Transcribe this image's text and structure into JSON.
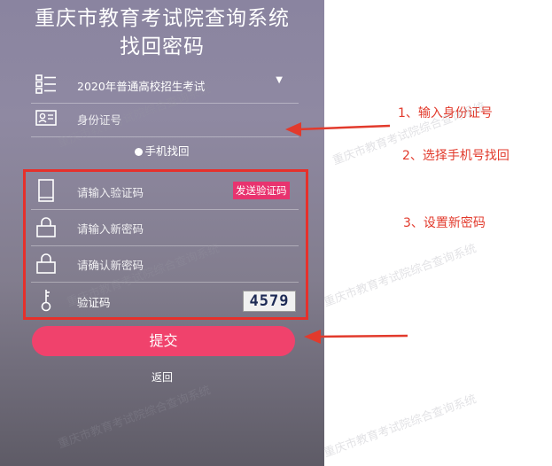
{
  "header": {
    "title_line1": "重庆市教育考试院查询系统",
    "title_line2": "找回密码"
  },
  "exam_select": {
    "value": "2020年普通高校招生考试"
  },
  "id_field": {
    "placeholder": "身份证号"
  },
  "recovery_option": {
    "label": "手机找回"
  },
  "verify_code_field": {
    "placeholder": "请输入验证码"
  },
  "send_code_button": {
    "label": "发送验证码"
  },
  "new_password_field": {
    "placeholder": "请输入新密码"
  },
  "confirm_password_field": {
    "placeholder": "请确认新密码"
  },
  "captcha_field": {
    "label": "验证码",
    "image_text": "4579"
  },
  "submit_button": {
    "label": "提交"
  },
  "back_link": {
    "label": "返回"
  },
  "annotations": {
    "step1": "1、输入身份证号",
    "step2": "2、选择手机号找回",
    "step3": "3、设置新密码"
  },
  "watermark": "重庆市教育考试院综合查询系统",
  "colors": {
    "annotation_red": "#e23a2c",
    "submit_pink": "#f0426c",
    "send_code_pink": "#e8336f"
  }
}
